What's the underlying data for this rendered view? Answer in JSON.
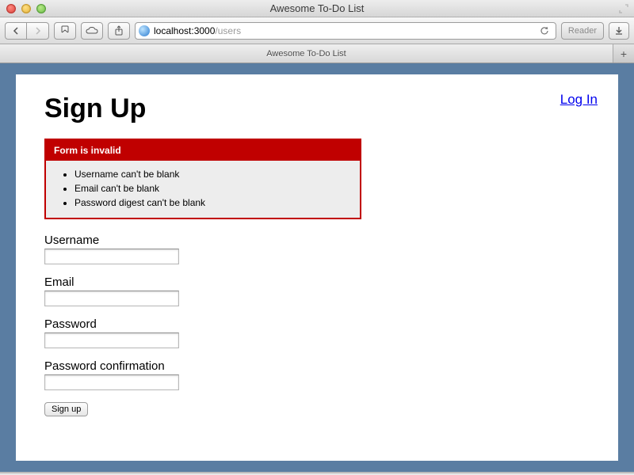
{
  "window": {
    "title": "Awesome To-Do List"
  },
  "toolbar": {
    "url_host": "localhost:3000",
    "url_path": "/users",
    "reader_label": "Reader"
  },
  "tabs": [
    {
      "label": "Awesome To-Do List"
    }
  ],
  "page": {
    "login_link": "Log In",
    "heading": "Sign Up",
    "error": {
      "title": "Form is invalid",
      "messages": [
        "Username can't be blank",
        "Email can't be blank",
        "Password digest can't be blank"
      ]
    },
    "fields": {
      "username": {
        "label": "Username",
        "value": ""
      },
      "email": {
        "label": "Email",
        "value": ""
      },
      "password": {
        "label": "Password",
        "value": ""
      },
      "password_confirmation": {
        "label": "Password confirmation",
        "value": ""
      }
    },
    "submit_label": "Sign up"
  }
}
